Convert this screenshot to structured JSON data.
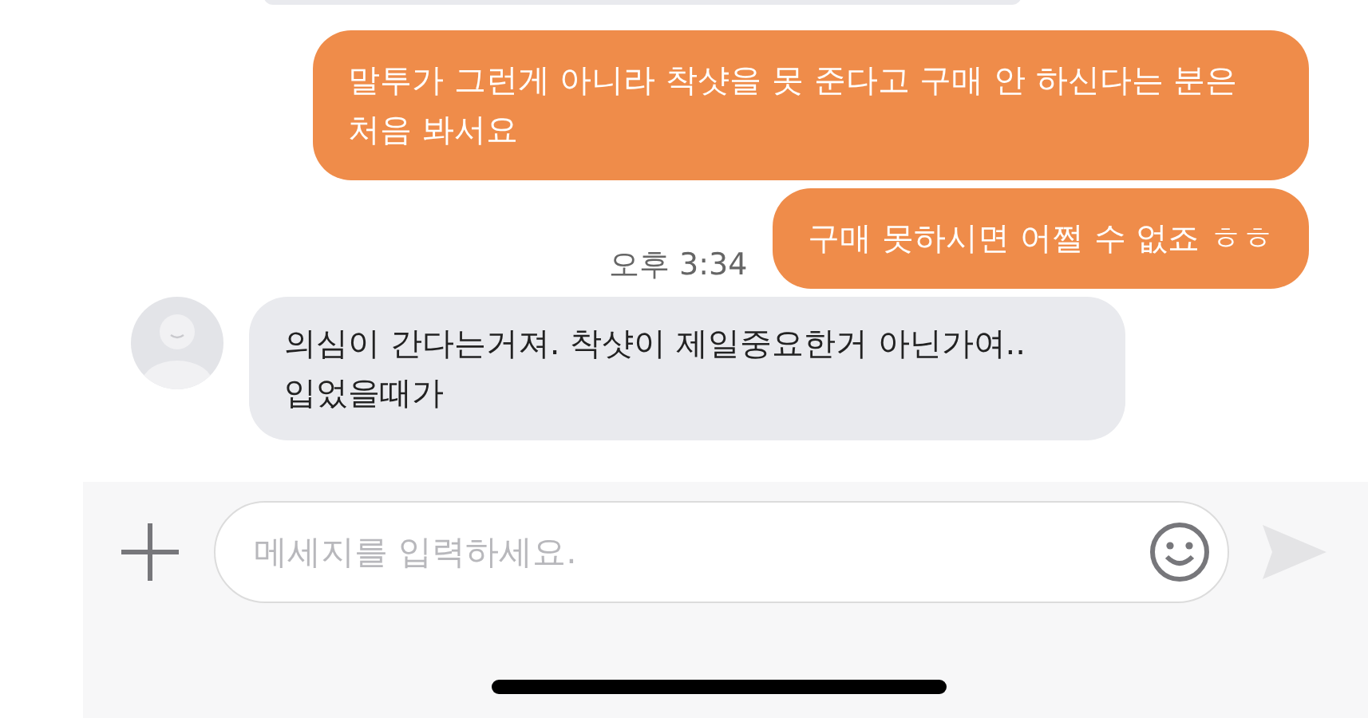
{
  "messages": [
    {
      "kind": "outgoing",
      "text": "말투가 그런게 아니라 착샷을 못 준다고 구매 안 하신다는 분은 처음 봐서요"
    },
    {
      "kind": "outgoing",
      "text": "구매 못하시면 어쩔 수 없죠 ㅎㅎ",
      "time": "오후 3:34"
    },
    {
      "kind": "incoming",
      "text": "의심이 간다는거져. 착샷이 제일중요한거 아닌가여.. 입었을때가"
    }
  ],
  "composer": {
    "placeholder": "메세지를 입력하세요."
  }
}
